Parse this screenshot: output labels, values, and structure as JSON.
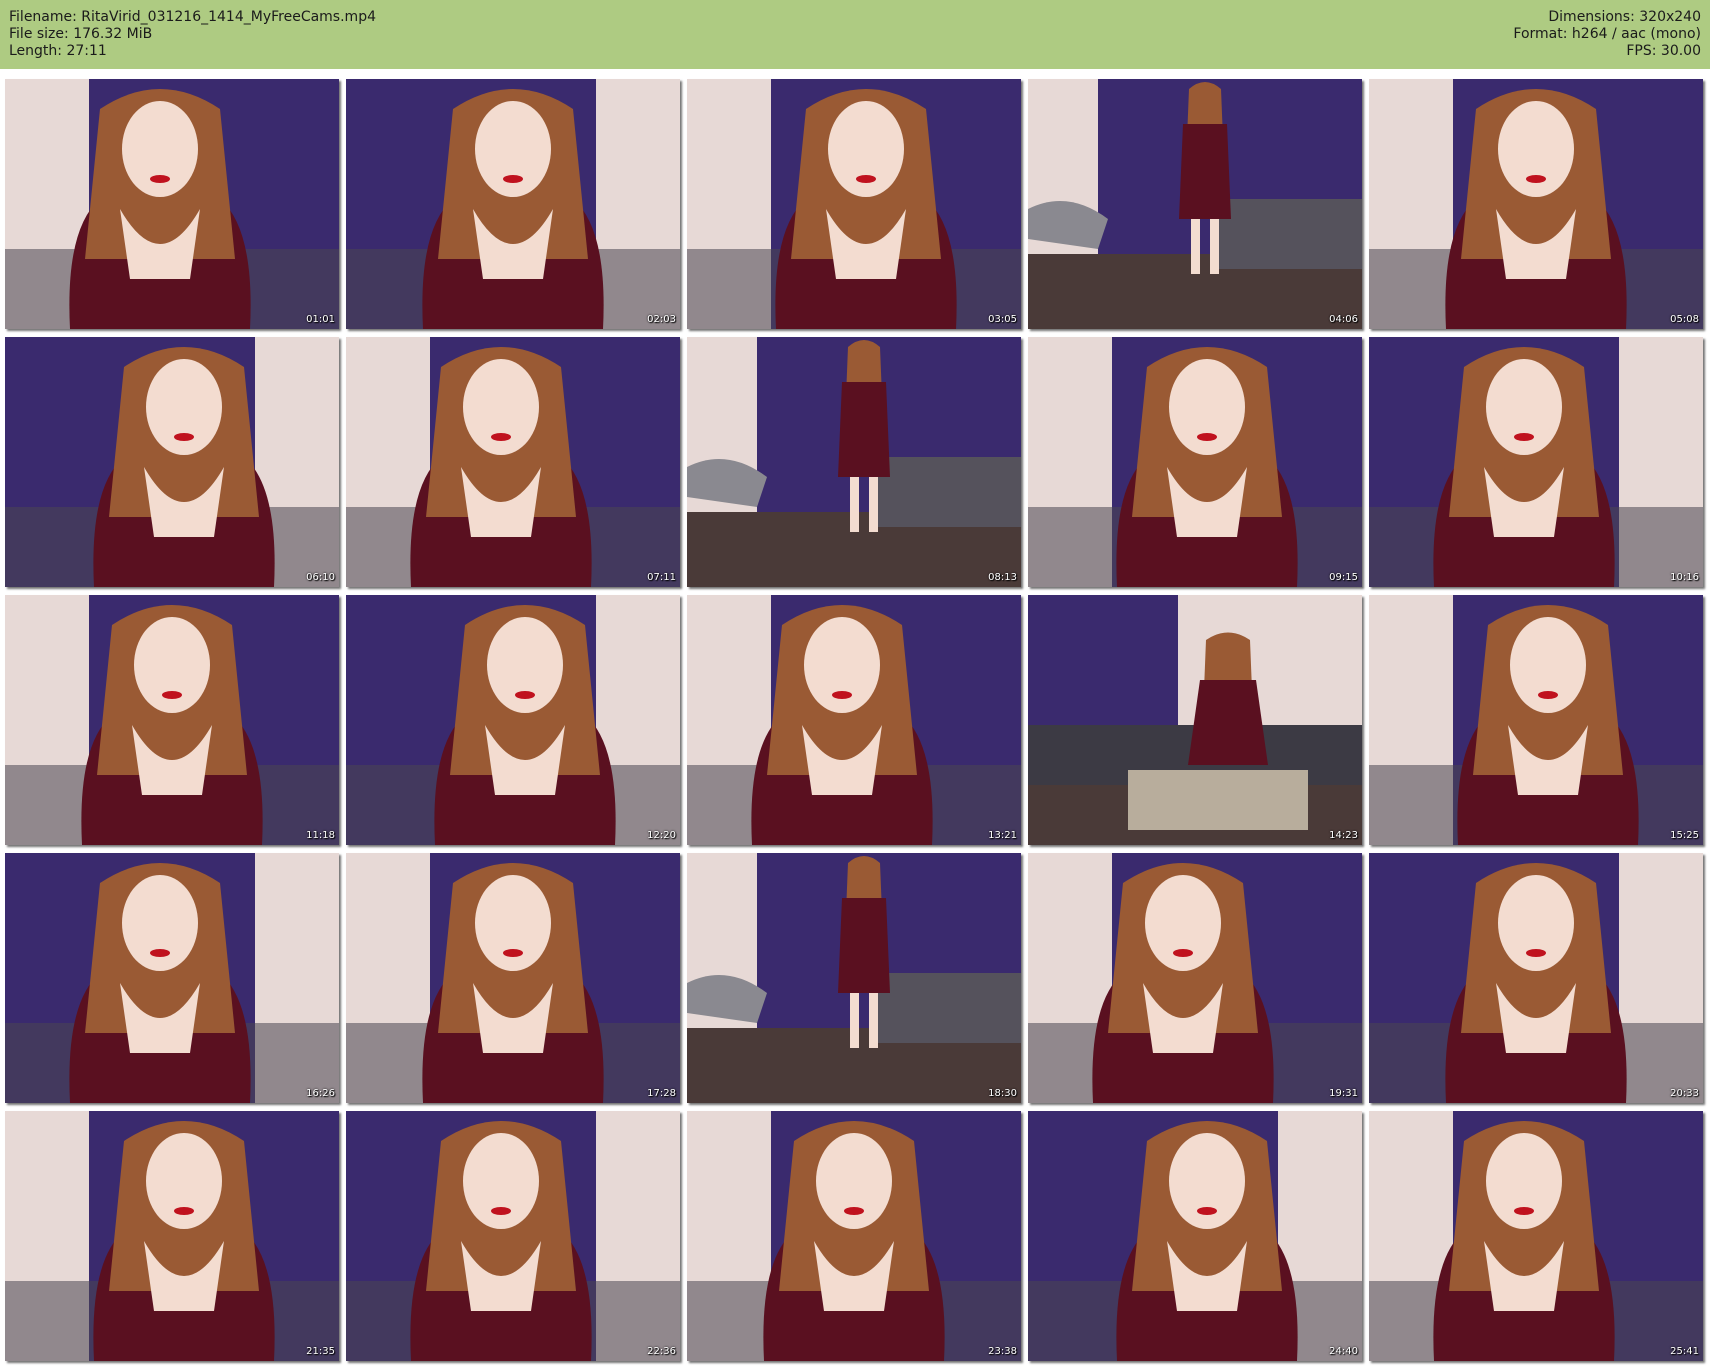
{
  "header": {
    "filename_line": "Filename: RitaVirid_031216_1414_MyFreeCams.mp4",
    "filesize_line": "File size: 176.32 MiB",
    "length_line": "Length: 27:11",
    "dimensions_line": "Dimensions: 320x240",
    "format_line": "Format: h264 / aac (mono)",
    "fps_line": "FPS: 30.00"
  },
  "colors": {
    "header_bg": "#aecb82",
    "curtain": "#3a2a6e",
    "wall": "#e7d9d6",
    "dress": "#5a1020",
    "hair": "#9a5a34",
    "skin": "#f3dcd0"
  },
  "thumbnails": [
    {
      "time": "01:01",
      "scene": "closeup"
    },
    {
      "time": "02:03",
      "scene": "closeup"
    },
    {
      "time": "03:05",
      "scene": "closeup"
    },
    {
      "time": "04:06",
      "scene": "standing"
    },
    {
      "time": "05:08",
      "scene": "closeup"
    },
    {
      "time": "06:10",
      "scene": "closeup"
    },
    {
      "time": "07:11",
      "scene": "closeup"
    },
    {
      "time": "08:13",
      "scene": "standing"
    },
    {
      "time": "09:15",
      "scene": "closeup"
    },
    {
      "time": "10:16",
      "scene": "closeup"
    },
    {
      "time": "11:18",
      "scene": "closeup"
    },
    {
      "time": "12:20",
      "scene": "closeup"
    },
    {
      "time": "13:21",
      "scene": "closeup"
    },
    {
      "time": "14:23",
      "scene": "kneeling"
    },
    {
      "time": "15:25",
      "scene": "closeup"
    },
    {
      "time": "16:26",
      "scene": "closeup"
    },
    {
      "time": "17:28",
      "scene": "closeup"
    },
    {
      "time": "18:30",
      "scene": "standing"
    },
    {
      "time": "19:31",
      "scene": "closeup"
    },
    {
      "time": "20:33",
      "scene": "closeup"
    },
    {
      "time": "21:35",
      "scene": "closeup"
    },
    {
      "time": "22:36",
      "scene": "closeup"
    },
    {
      "time": "23:38",
      "scene": "closeup"
    },
    {
      "time": "24:40",
      "scene": "closeup"
    },
    {
      "time": "25:41",
      "scene": "closeup"
    }
  ]
}
